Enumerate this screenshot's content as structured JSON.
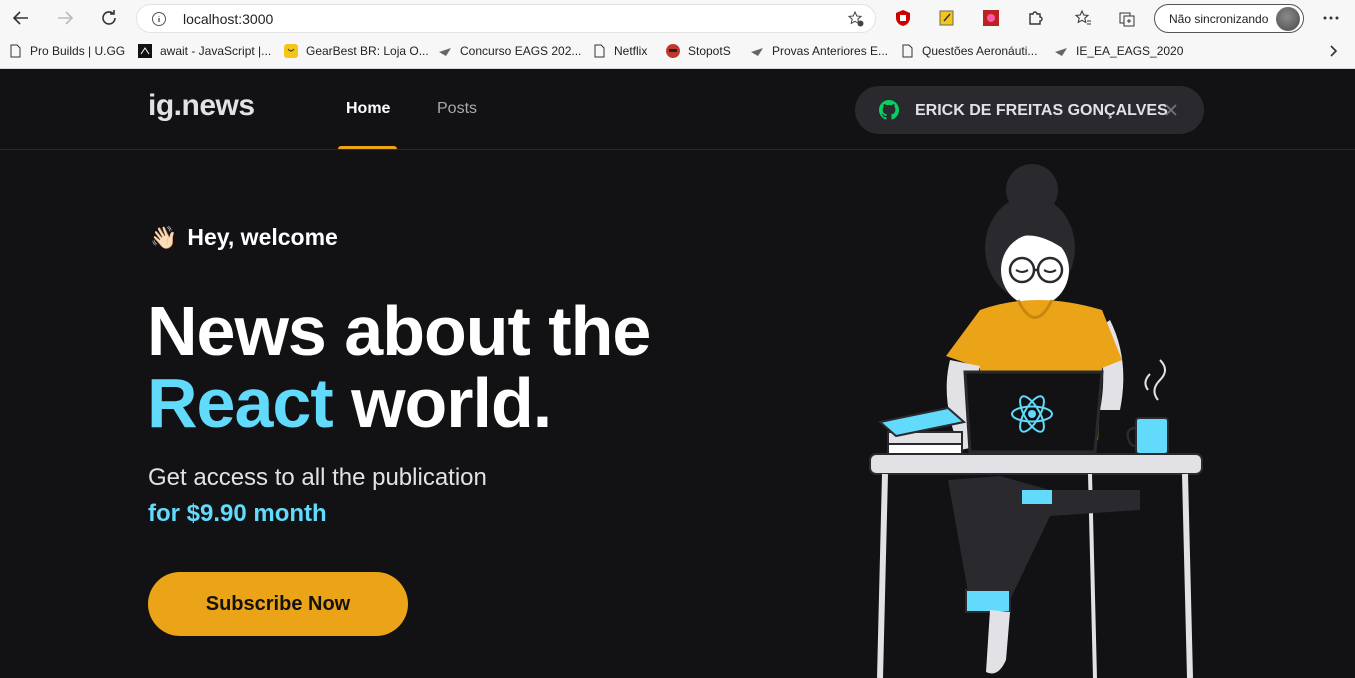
{
  "browser": {
    "url": "localhost:3000",
    "sync_label": "Não sincronizando"
  },
  "bookmarks": [
    {
      "label": "Pro Builds | U.GG",
      "icon": "page-icon"
    },
    {
      "label": "await - JavaScript |...",
      "icon": "mdn-icon"
    },
    {
      "label": "GearBest BR: Loja O...",
      "icon": "gearbest-icon"
    },
    {
      "label": "Concurso EAGS 202...",
      "icon": "eags-icon"
    },
    {
      "label": "Netflix",
      "icon": "page-icon"
    },
    {
      "label": "StopotS",
      "icon": "stopots-icon"
    },
    {
      "label": "Provas Anteriores E...",
      "icon": "eags-icon"
    },
    {
      "label": "Questões Aeronáuti...",
      "icon": "page-icon"
    },
    {
      "label": "IE_EA_EAGS_2020",
      "icon": "eags-icon"
    }
  ],
  "site": {
    "logo": "ig.news",
    "nav": {
      "home": "Home",
      "posts": "Posts"
    },
    "user_name": "ERICK DE FREITAS GONÇALVES",
    "hello": "Hey, welcome",
    "hello_emoji": "👋🏻",
    "headline_line1": "News about the",
    "headline_accent": "React",
    "headline_rest": " world.",
    "subtitle": "Get access to all the publication",
    "price": "for $9.90 month",
    "cta": "Subscribe Now",
    "colors": {
      "background": "#121214",
      "accent": "#eba417",
      "react": "#61dafb"
    }
  }
}
